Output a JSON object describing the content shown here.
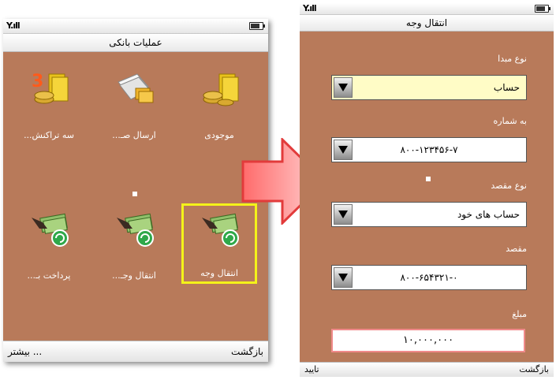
{
  "colors": {
    "screen_bg": "#b87a5a",
    "selection_border": "#f4f21a",
    "arrow": "#ee3b3b"
  },
  "left_phone": {
    "status_icons": {
      "signal": "Y.ıll",
      "battery_icon": "battery-icon"
    },
    "title": "عملیات بانکی",
    "menu_items": [
      {
        "label": "موجودی",
        "icon": "balance-coins-icon",
        "selected": false
      },
      {
        "label": "ارسال صـ...",
        "icon": "send-statement-icon",
        "selected": false
      },
      {
        "label": "سه تراکنش...",
        "icon": "three-transactions-icon",
        "badge": "3",
        "selected": false
      },
      {
        "label": "انتقال وجه",
        "icon": "money-transfer-icon",
        "selected": true
      },
      {
        "label": "انتقال وجـ...",
        "icon": "money-transfer-icon",
        "selected": false
      },
      {
        "label": "پرداخت بـ...",
        "icon": "bill-payment-icon",
        "selected": false
      }
    ],
    "softkeys": {
      "left": "بیشتر ...",
      "right": "بازگشت"
    }
  },
  "right_phone": {
    "status_icons": {
      "signal": "Y.ıll",
      "battery_icon": "battery-icon"
    },
    "title": "انتقال وجه",
    "fields": {
      "source_type_label": "نوع مبدا",
      "source_type_value": "حساب",
      "to_number_label": "به شماره",
      "to_number_value": "۸۰۰-۱۲۳۴۵۶-۷",
      "dest_type_label": "نوع مقصد",
      "dest_type_value": "حساب های خود",
      "dest_label": "مقصد",
      "dest_value": "۸۰۰-۶۵۴۳۲۱-۰",
      "amount_label": "مبلغ",
      "amount_value": "۱۰,۰۰۰,۰۰۰"
    },
    "softkeys": {
      "left": "تایید",
      "right": "بازگشت"
    }
  }
}
